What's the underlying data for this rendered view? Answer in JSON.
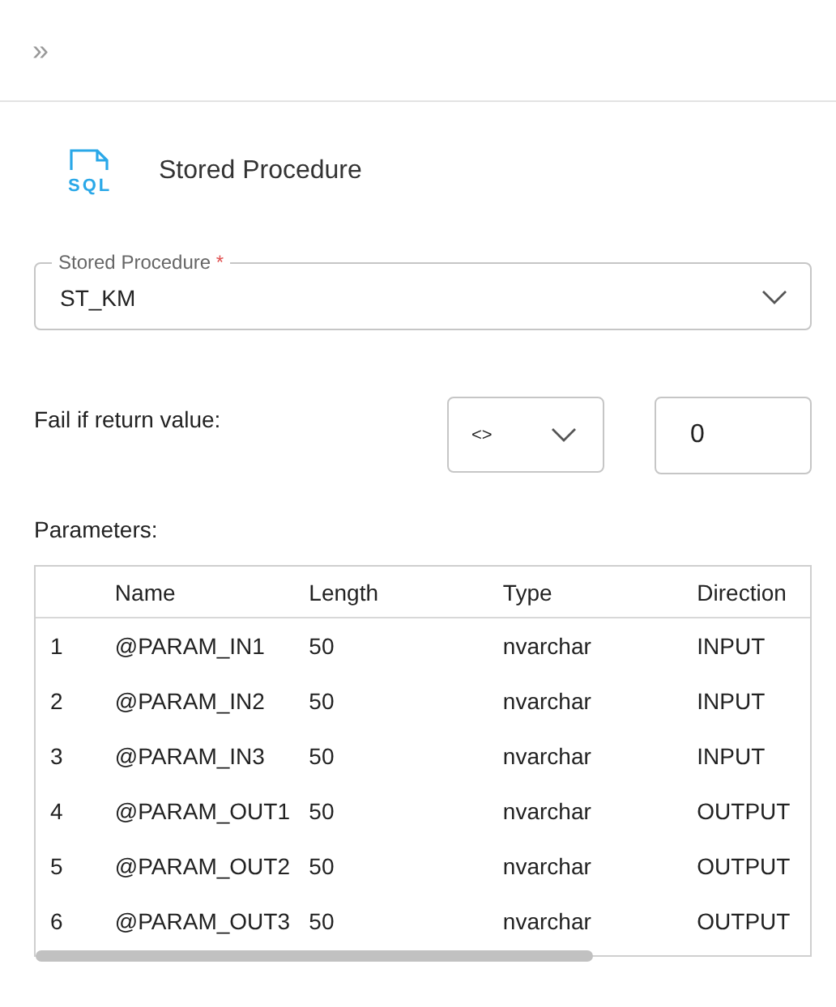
{
  "toolbar": {
    "expand_icon": "»"
  },
  "header": {
    "icon_text": "SQL",
    "title": "Stored Procedure"
  },
  "procedure_field": {
    "label": "Stored Procedure",
    "required_mark": "*",
    "value": "ST_KM"
  },
  "return_check": {
    "label": "Fail if return value:",
    "operator": "<>",
    "value": "0"
  },
  "parameters": {
    "label": "Parameters:",
    "columns": [
      "Name",
      "Length",
      "Type",
      "Direction"
    ],
    "rows": [
      {
        "number": "1",
        "name": "@PARAM_IN1",
        "length": "50",
        "type": "nvarchar",
        "direction": "INPUT"
      },
      {
        "number": "2",
        "name": "@PARAM_IN2",
        "length": "50",
        "type": "nvarchar",
        "direction": "INPUT"
      },
      {
        "number": "3",
        "name": "@PARAM_IN3",
        "length": "50",
        "type": "nvarchar",
        "direction": "INPUT"
      },
      {
        "number": "4",
        "name": "@PARAM_OUT1",
        "length": "50",
        "type": "nvarchar",
        "direction": "OUTPUT"
      },
      {
        "number": "5",
        "name": "@PARAM_OUT2",
        "length": "50",
        "type": "nvarchar",
        "direction": "OUTPUT"
      },
      {
        "number": "6",
        "name": "@PARAM_OUT3",
        "length": "50",
        "type": "nvarchar",
        "direction": "OUTPUT"
      }
    ]
  }
}
